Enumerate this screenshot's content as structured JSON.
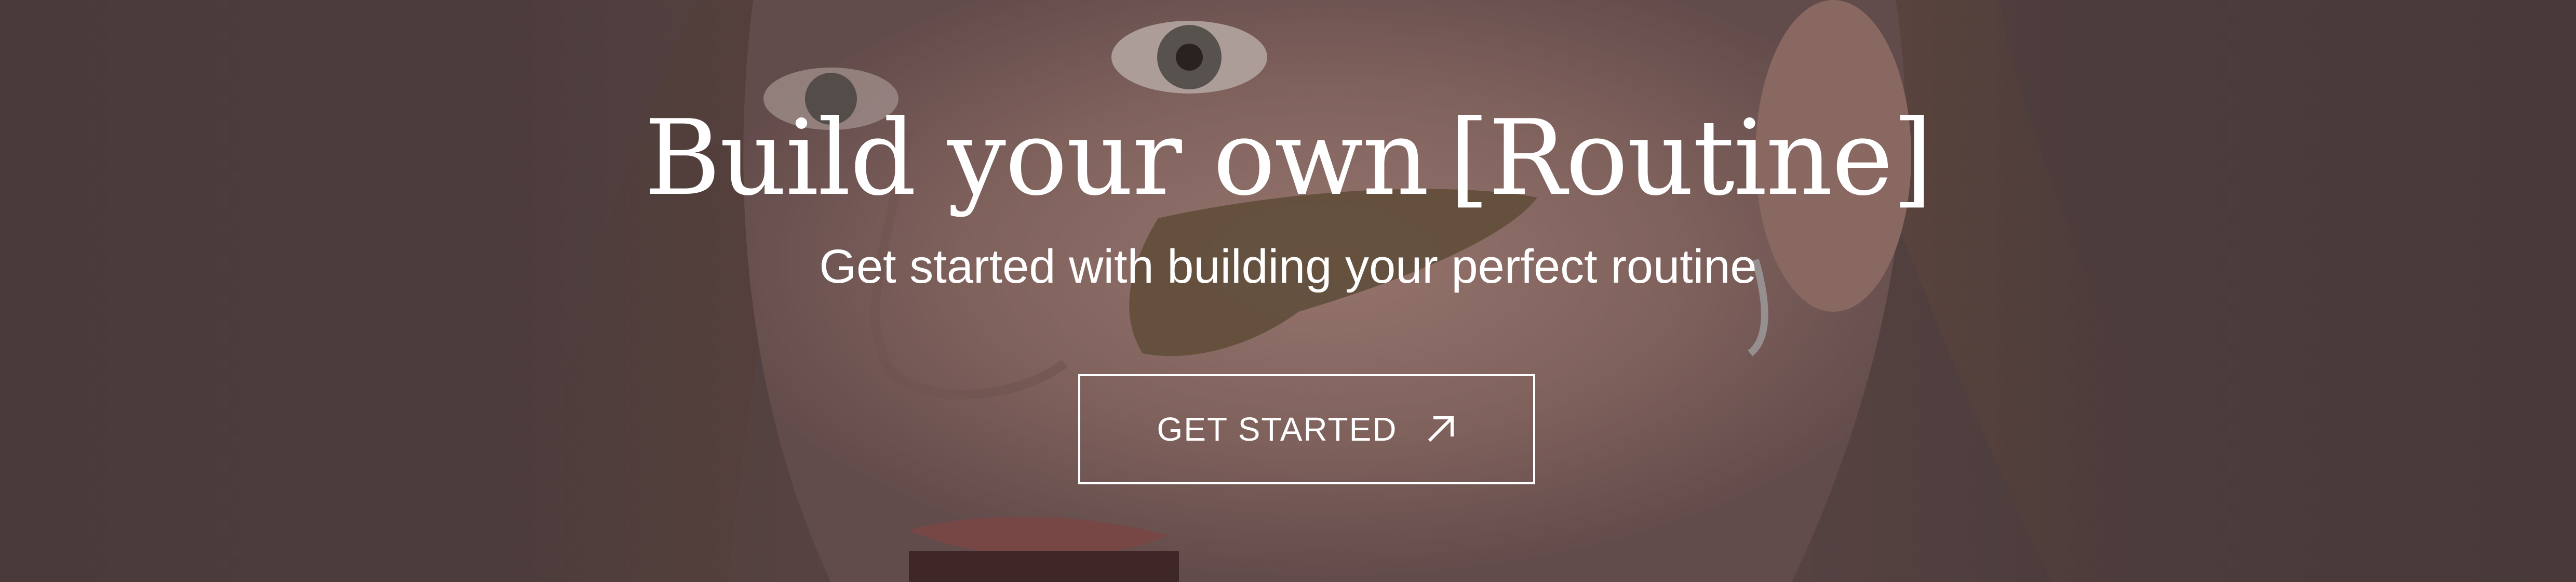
{
  "hero": {
    "headline_main": "Build your own",
    "headline_bracket": "[Routine]",
    "subheadline": "Get started with building your perfect routine",
    "cta_label": "GET STARTED",
    "cta_icon": "arrow-up-right-icon",
    "background_image": "face-portrait-photo"
  },
  "colors": {
    "text": "#ffffff",
    "overlay": "#2d1e1e"
  }
}
